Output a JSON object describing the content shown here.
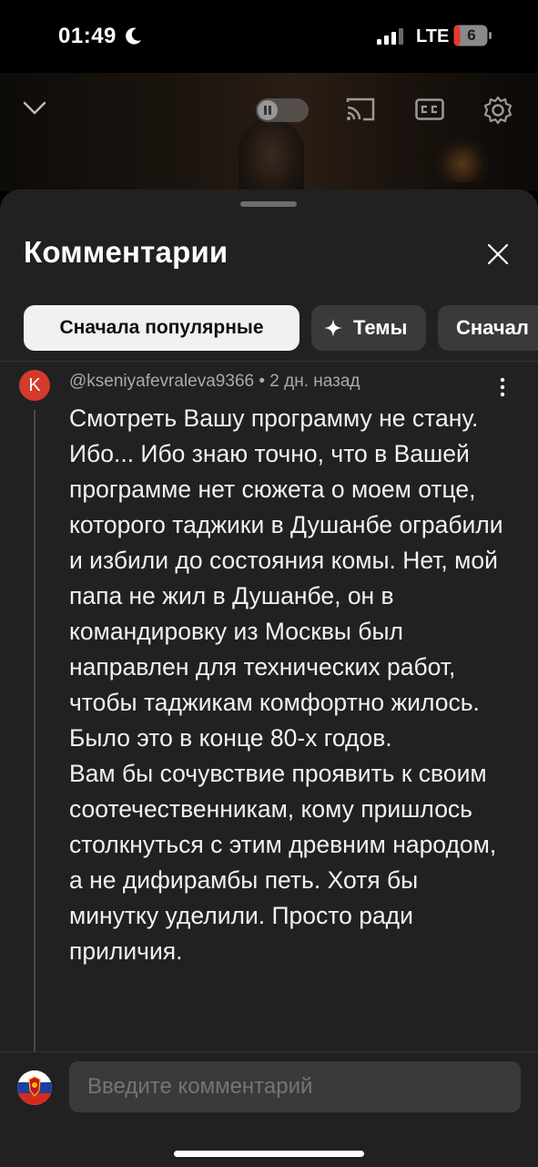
{
  "status_bar": {
    "time": "01:49",
    "network": "LTE",
    "battery": "6"
  },
  "video": {
    "icons": [
      "chevron-down-icon",
      "pause-icon",
      "cast-icon",
      "captions-icon",
      "settings-gear-icon"
    ]
  },
  "comments_panel": {
    "title": "Комментарии",
    "filters": [
      {
        "label": "Сначала популярные",
        "selected": true
      },
      {
        "label": "Темы",
        "icon": "sparkle-icon",
        "selected": false
      },
      {
        "label": "Сначал",
        "selected": false
      }
    ]
  },
  "comment": {
    "avatar_letter": "K",
    "author": "@kseniyafevraleva9366",
    "separator": " • ",
    "time": "2 дн. назад",
    "text": "Смотреть Вашу программу не стану. Ибо... Ибо знаю точно, что в Вашей программе нет сюжета о моем отце, которого таджики в Душанбе ограбили и избили до состояния комы. Нет, мой папа не жил в Душанбе, он в командировку из Москвы был направлен для технических работ, чтобы таджикам комфортно жилось. Было это в конце 80-х годов.\nВам бы сочувствие проявить к своим соотечественникам, кому пришлось столкнуться с этим древним народом, а не дифирамбы петь. Хотя бы минутку уделили. Просто ради приличия."
  },
  "composer": {
    "placeholder": "Введите комментарий"
  },
  "colors": {
    "sheet_bg": "#212121",
    "chip_selected_bg": "#f1f1f1",
    "chip_bg": "#3a3a3a",
    "avatar_bg": "#d43a2c"
  }
}
